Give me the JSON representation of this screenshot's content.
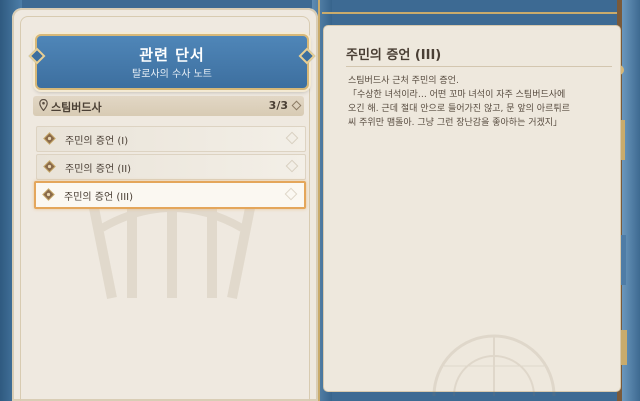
{
  "header": {
    "title": "관련 단서",
    "subtitle": "탈로사의 수사 노트"
  },
  "category": {
    "name": "스팀버드사",
    "count": "3/3",
    "icon": "location-pin-icon"
  },
  "entries": [
    {
      "label": "주민의 증언 (I)",
      "selected": false
    },
    {
      "label": "주민의 증언 (II)",
      "selected": false
    },
    {
      "label": "주민의 증언 (III)",
      "selected": true
    }
  ],
  "detail": {
    "title": "주민의 증언 (III)",
    "lines": [
      "스팀버드사 근처 주민의 증언.",
      "「수상한 녀석이라… 어떤 꼬마 녀석이 자주 스팀버드사에",
      "오긴 해. 근데 절대 안으로 들어가진 않고, 문 앞의 아르튀르",
      "씨 주위만 맴돌아. 그냥 그런 장난감을 좋아하는 거겠지」"
    ]
  },
  "colors": {
    "header_blue": "#3d6f9f",
    "panel_paper": "#efe9e0",
    "gold_accent": "#d7b878",
    "selected_border": "#e4a65b"
  }
}
